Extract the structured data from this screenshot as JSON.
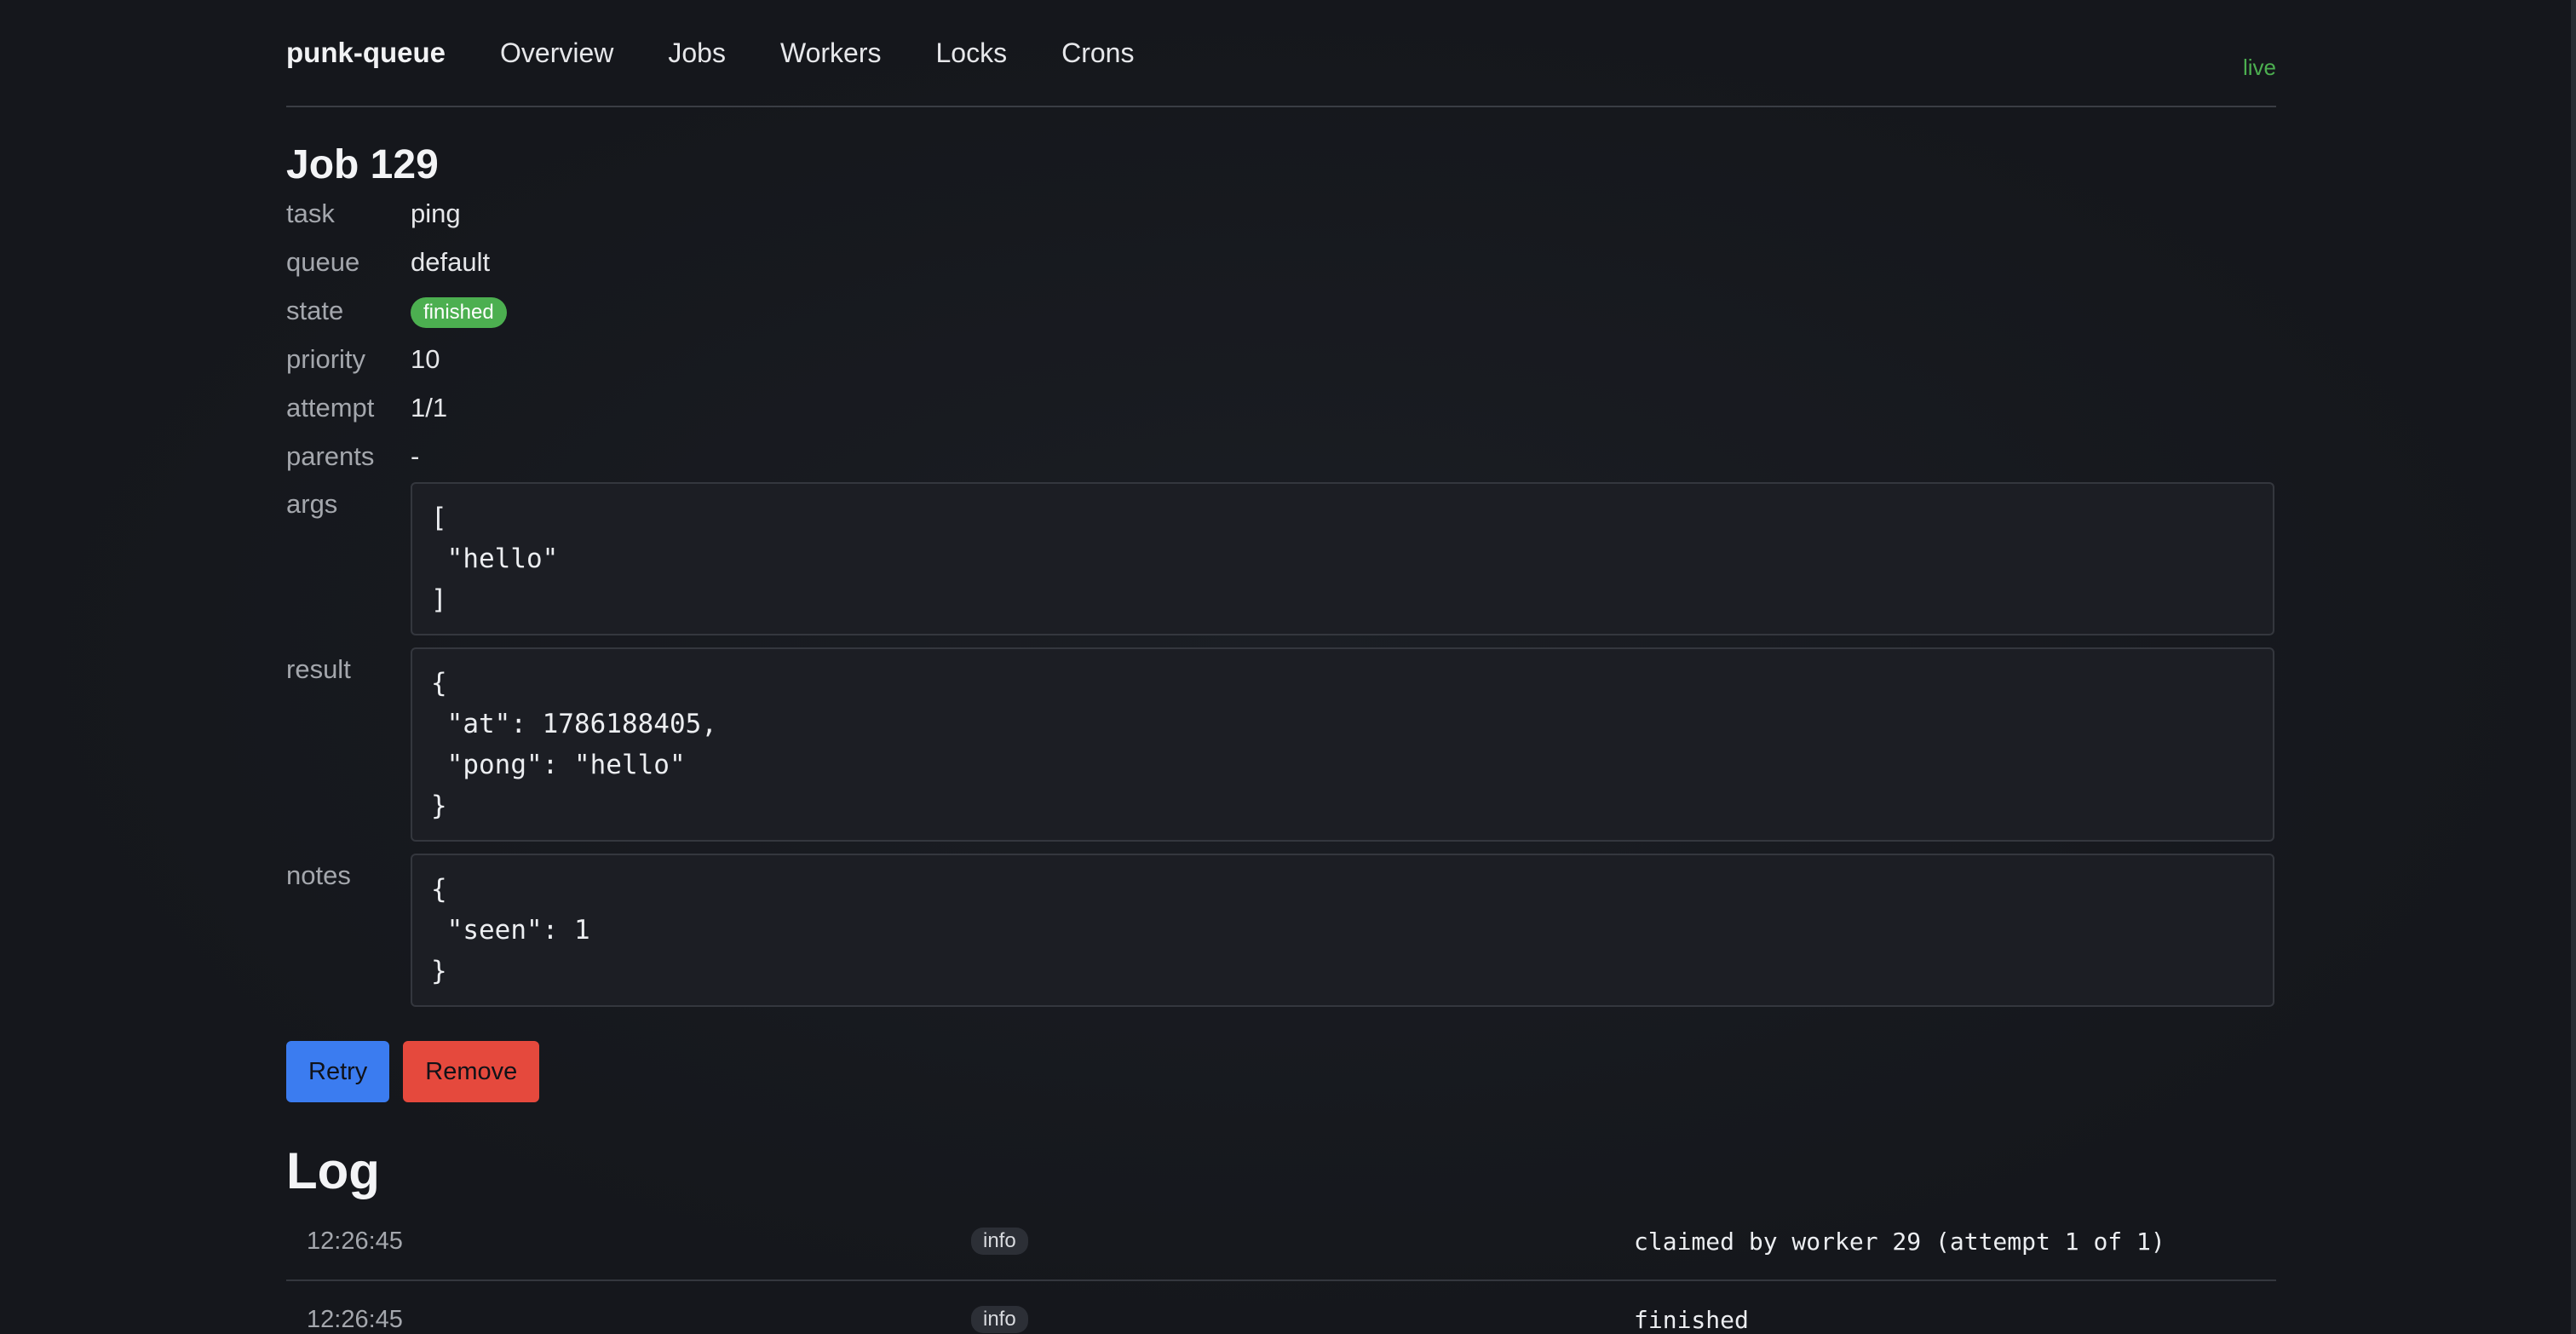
{
  "nav": {
    "brand": "punk-queue",
    "links": [
      "Overview",
      "Jobs",
      "Workers",
      "Locks",
      "Crons"
    ],
    "status": "live"
  },
  "job": {
    "title": "Job 129",
    "fields": {
      "task": {
        "label": "task",
        "value": "ping"
      },
      "queue": {
        "label": "queue",
        "value": "default"
      },
      "state": {
        "label": "state",
        "value": "finished"
      },
      "priority": {
        "label": "priority",
        "value": "10"
      },
      "attempt": {
        "label": "attempt",
        "value": "1/1"
      },
      "parents": {
        "label": "parents",
        "value": "-"
      }
    },
    "args": {
      "label": "args",
      "value": "[\n \"hello\"\n]"
    },
    "result": {
      "label": "result",
      "value": "{\n \"at\": 1786188405,\n \"pong\": \"hello\"\n}"
    },
    "notes": {
      "label": "notes",
      "value": "{\n \"seen\": 1\n}"
    }
  },
  "actions": {
    "retry": "Retry",
    "remove": "Remove"
  },
  "colors": {
    "state_finished": "#4caf50",
    "retry": "#3b7cf0",
    "remove": "#e5493d"
  },
  "log": {
    "title": "Log",
    "entries": [
      {
        "time": "12:26:45",
        "level": "info",
        "message": "claimed by worker 29 (attempt 1 of 1)"
      },
      {
        "time": "12:26:45",
        "level": "info",
        "message": "finished"
      }
    ]
  }
}
